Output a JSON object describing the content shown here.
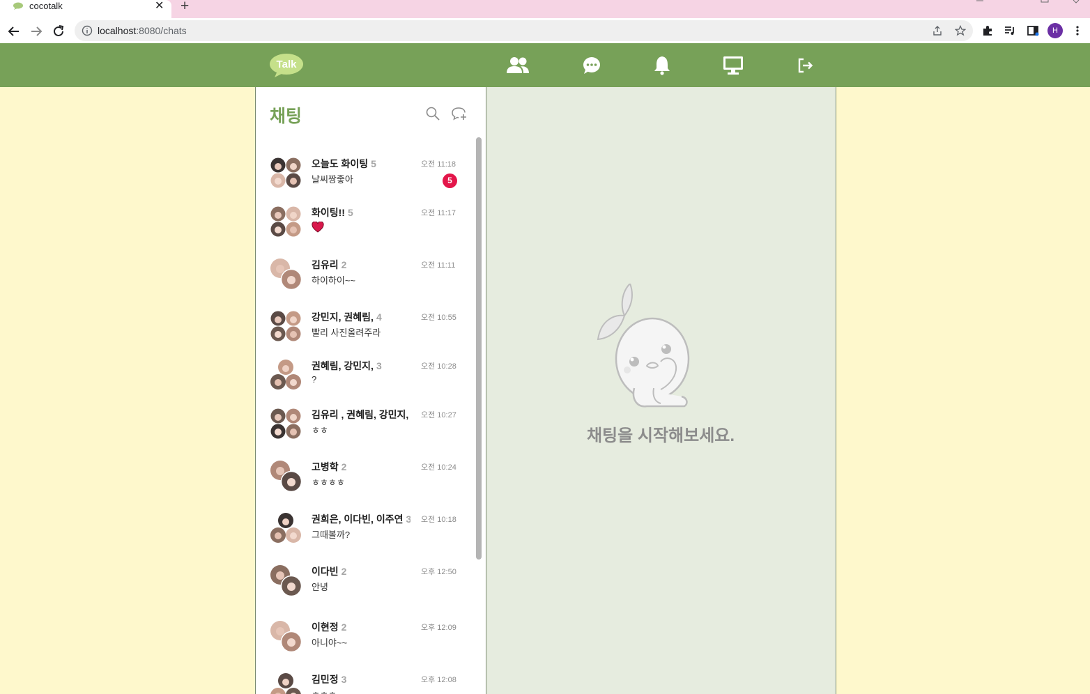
{
  "browser": {
    "tab_title": "cocotalk",
    "tab_close": "✕",
    "new_tab": "+",
    "url_host": "localhost",
    "url_path": ":8080/chats",
    "profile_initial": "H"
  },
  "header": {
    "logo_text": "Talk",
    "accent_color": "#77a158"
  },
  "chat_list": {
    "title": "채팅",
    "items": [
      {
        "name": "오늘도 화이팅",
        "count": "5",
        "message": "날씨짱좋아",
        "time": "오전 11:18",
        "unread": "5",
        "avatar": "group4"
      },
      {
        "name": "화이팅!!",
        "count": "5",
        "message": "",
        "time": "오전 11:17",
        "unread": "",
        "avatar": "group4",
        "message_icon": "heart-icon"
      },
      {
        "name": "김유리",
        "count": "2",
        "message": "하이하이~~",
        "time": "오전 11:11",
        "unread": "",
        "avatar": "pair"
      },
      {
        "name": "강민지, 권혜림,",
        "count": "4",
        "message": "빨리 사진올려주라",
        "time": "오전 10:55",
        "unread": "",
        "avatar": "group4"
      },
      {
        "name": "권혜림, 강민지,",
        "count": "3",
        "message": "?",
        "time": "오전 10:28",
        "unread": "",
        "avatar": "group3"
      },
      {
        "name": "김유리 , 권혜림, 강민지,",
        "count": "",
        "message": "ㅎㅎ",
        "time": "오전 10:27",
        "unread": "",
        "avatar": "group4"
      },
      {
        "name": "고병학",
        "count": "2",
        "message": "ㅎㅎㅎㅎ",
        "time": "오전 10:24",
        "unread": "",
        "avatar": "pair"
      },
      {
        "name": "권희은, 이다빈, 이주연",
        "count": "3",
        "message": "그때볼까?",
        "time": "오전 10:18",
        "unread": "",
        "avatar": "group3"
      },
      {
        "name": "이다빈",
        "count": "2",
        "message": "안녕",
        "time": "오후 12:50",
        "unread": "",
        "avatar": "pair"
      },
      {
        "name": "이현정",
        "count": "2",
        "message": "아니야~~",
        "time": "오후 12:09",
        "unread": "",
        "avatar": "pair"
      },
      {
        "name": "김민정",
        "count": "3",
        "message": "ㅎㅎㅎ",
        "time": "오후 12:08",
        "unread": "",
        "avatar": "group3"
      }
    ]
  },
  "main": {
    "empty_message": "채팅을 시작해보세요."
  }
}
